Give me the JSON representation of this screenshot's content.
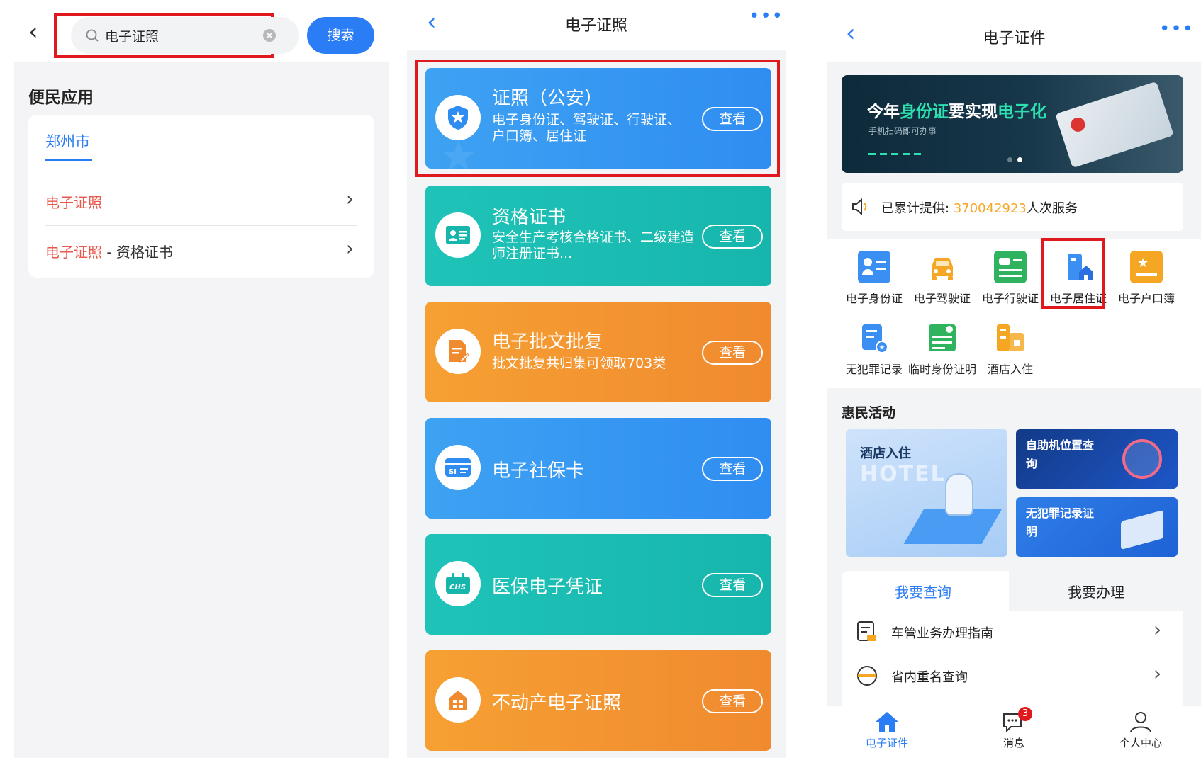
{
  "left": {
    "search_value": "电子证照",
    "search_button": "搜索",
    "section_title": "便民应用",
    "city_tab": "郑州市",
    "results": [
      {
        "highlight": "电子证照",
        "rest": ""
      },
      {
        "highlight": "电子证照",
        "rest": " - 资格证书"
      }
    ]
  },
  "middle": {
    "title": "电子证照",
    "view_label": "查看",
    "services": [
      {
        "title": "证照（公安）",
        "desc": "电子身份证、驾驶证、行驶证、户口簿、居住证",
        "icon": "shield-star-icon"
      },
      {
        "title": "资格证书",
        "desc": "安全生产考核合格证书、二级建造师注册证书...",
        "icon": "certificate-card-icon"
      },
      {
        "title": "电子批文批复",
        "desc": "批文批复共归集可领取703类",
        "icon": "document-edit-icon"
      },
      {
        "title": "电子社保卡",
        "desc": "",
        "icon": "social-security-card-icon",
        "badge": "SI"
      },
      {
        "title": "医保电子凭证",
        "desc": "",
        "icon": "medical-insurance-icon",
        "badge": "CHS"
      },
      {
        "title": "不动产电子证照",
        "desc": "",
        "icon": "building-icon"
      }
    ]
  },
  "right": {
    "title": "电子证件",
    "banner": {
      "line1_a": "今年",
      "line1_b": "身份证",
      "line1_c": "要实现",
      "line1_d": "电子化",
      "sub": "手机扫码即可办事"
    },
    "served_label": "已累计提供:",
    "served_count": "370042923",
    "served_unit": "人次服务",
    "grid": [
      {
        "label": "电子身份证",
        "icon": "id-card-icon",
        "color": "#3b8ff3"
      },
      {
        "label": "电子驾驶证",
        "icon": "car-icon",
        "color": "#f5a623"
      },
      {
        "label": "电子行驶证",
        "icon": "vehicle-license-icon",
        "color": "#2fb35e"
      },
      {
        "label": "电子居住证",
        "icon": "residence-permit-icon",
        "color": "#3b8ff3"
      },
      {
        "label": "电子户口簿",
        "icon": "household-register-icon",
        "color": "#f5a623"
      },
      {
        "label": "无犯罪记录",
        "icon": "no-crime-record-icon",
        "color": "#3b8ff3"
      },
      {
        "label": "临时身份证明",
        "icon": "temp-id-icon",
        "color": "#2fb35e"
      },
      {
        "label": "酒店入住",
        "icon": "hotel-icon",
        "color": "#f5a623"
      }
    ],
    "activity_title": "惠民活动",
    "activities": {
      "hotel": "酒店入住",
      "hotel_wm": "HOTEL",
      "kiosk": "自助机位置查询",
      "nocrime": "无犯罪记录证明"
    },
    "tabs": [
      "我要查询",
      "我要办理"
    ],
    "list": [
      "车管业务办理指南",
      "省内重名查询"
    ],
    "bottom_tabs": [
      {
        "label": "电子证件",
        "icon": "home-icon"
      },
      {
        "label": "消息",
        "icon": "message-icon",
        "badge": "3"
      },
      {
        "label": "个人中心",
        "icon": "person-icon"
      }
    ],
    "colors": {
      "accent": "#2a7df4",
      "count": "#f5a623",
      "highlight": "#e0191e"
    }
  }
}
